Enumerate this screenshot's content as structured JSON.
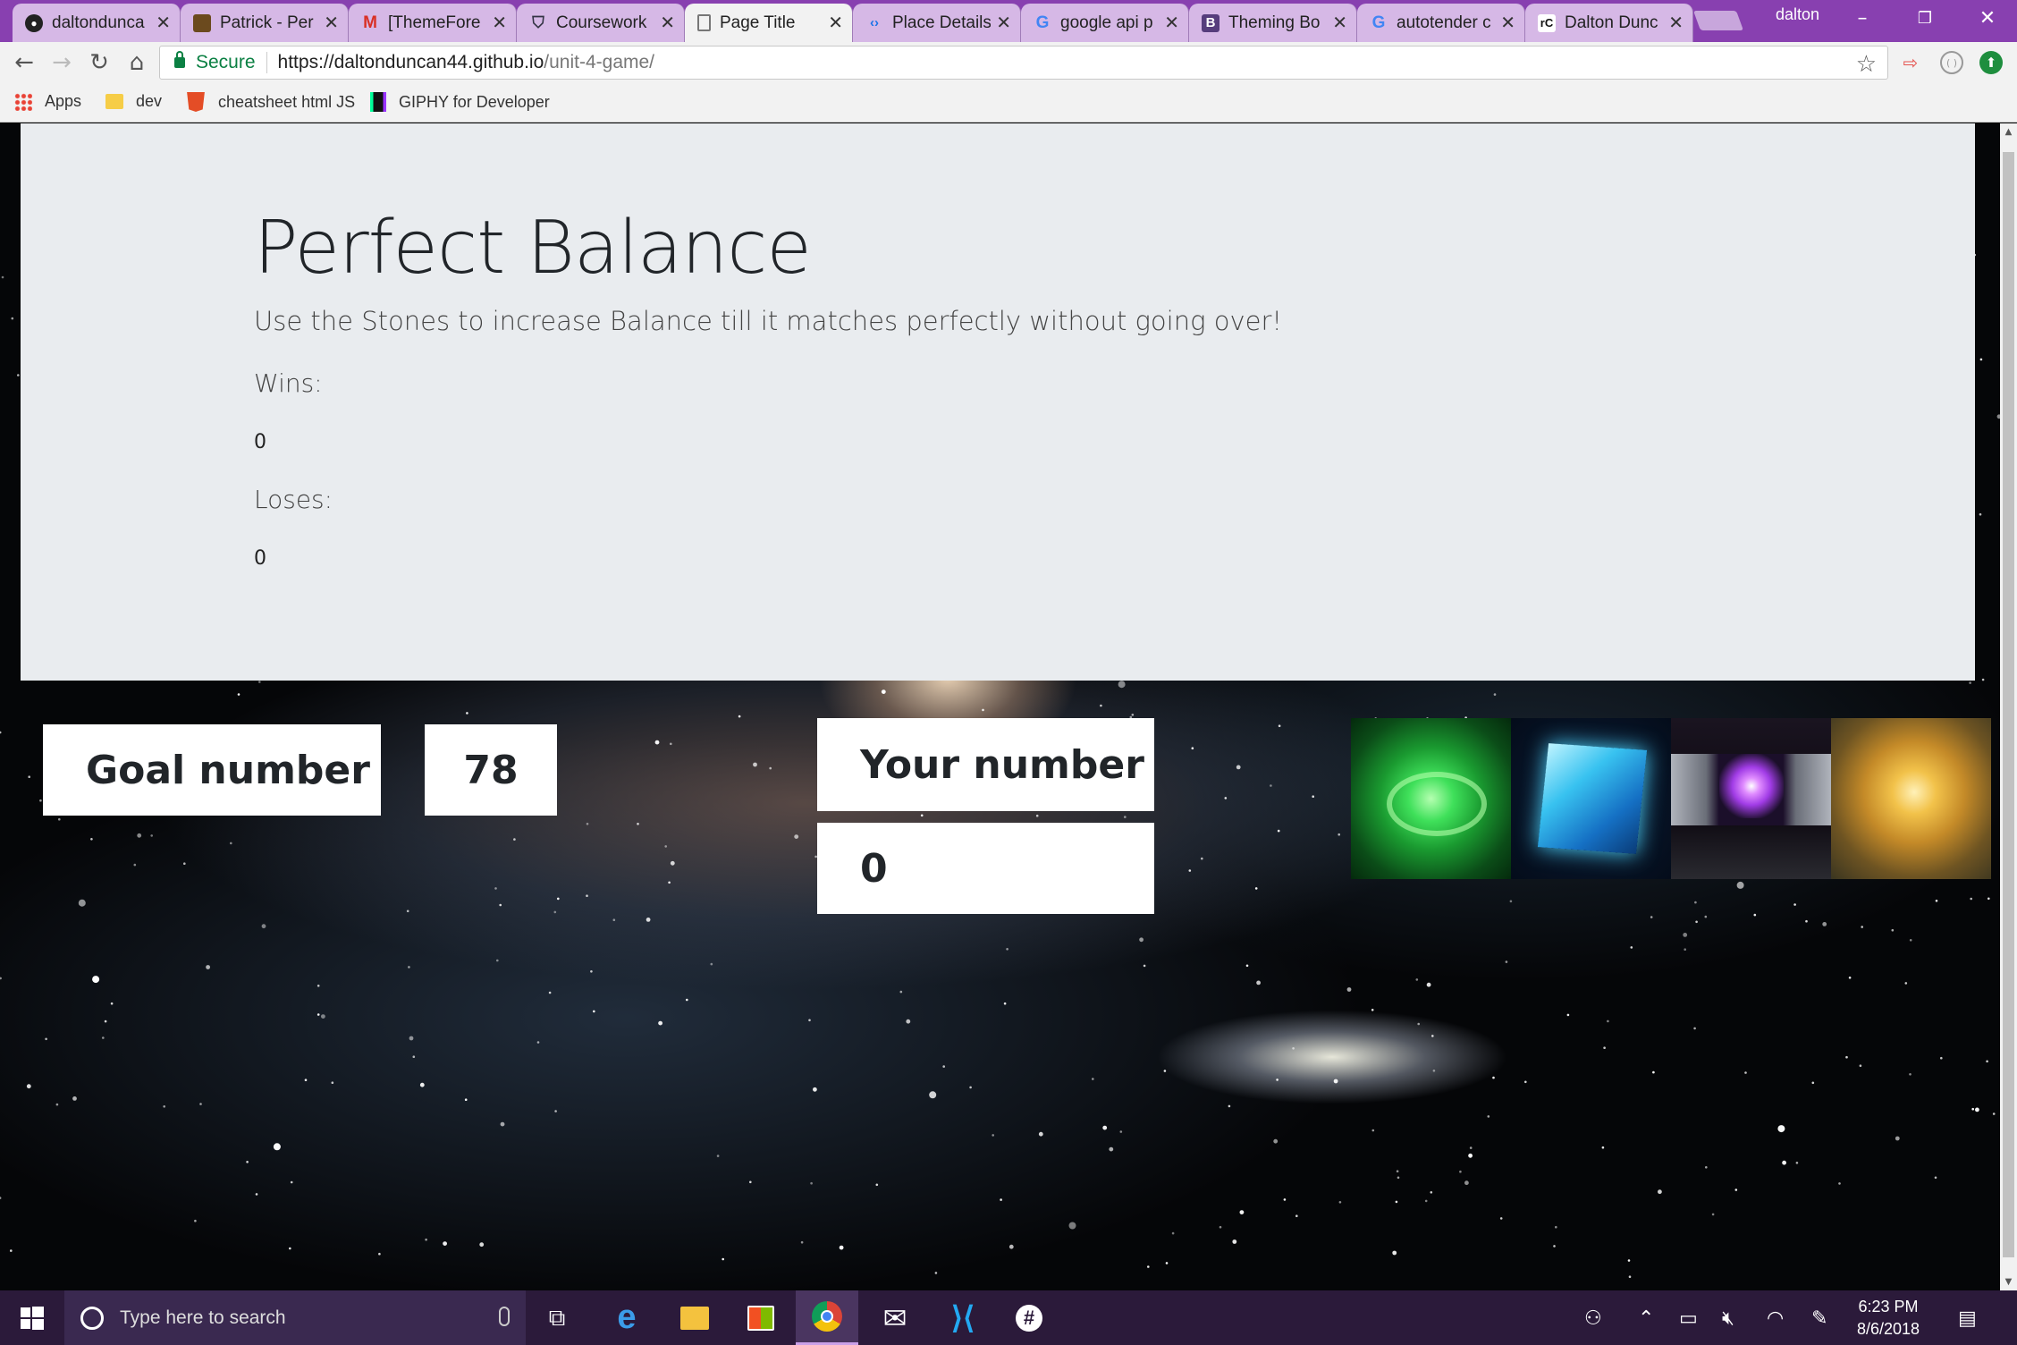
{
  "browser": {
    "tabs": [
      {
        "title": "daltondunca",
        "icon": "github-icon",
        "active": false
      },
      {
        "title": "Patrick - Per",
        "icon": "image-favicon-icon",
        "active": false
      },
      {
        "title": "[ThemeFore",
        "icon": "gmail-icon",
        "active": false
      },
      {
        "title": "Coursework",
        "icon": "shield-favicon-icon",
        "active": false
      },
      {
        "title": "Page Title",
        "icon": "page-icon",
        "active": true
      },
      {
        "title": "Place Details",
        "icon": "google-dev-icon",
        "active": false
      },
      {
        "title": "google api p",
        "icon": "google-icon",
        "active": false
      },
      {
        "title": "Theming Bo",
        "icon": "bootstrap-icon",
        "active": false
      },
      {
        "title": "autotender c",
        "icon": "google-icon",
        "active": false
      },
      {
        "title": "Dalton Dunc",
        "icon": "rc-icon",
        "active": false
      }
    ],
    "user_name": "dalton",
    "secure_label": "Secure",
    "url_host": "https://daltonduncan44.github.io",
    "url_path": "/unit-4-game/",
    "bookmarks": [
      {
        "label": "Apps",
        "icon": "apps-grid-icon"
      },
      {
        "label": "dev",
        "icon": "folder-icon"
      },
      {
        "label": "cheatsheet html JS",
        "icon": "html5-icon"
      },
      {
        "label": "GIPHY for Developer",
        "icon": "giphy-icon"
      }
    ]
  },
  "game": {
    "title": "Perfect Balance",
    "subtitle": "Use the Stones to increase Balance till it matches perfectly without going over!",
    "wins_label": "Wins:",
    "wins_value": "0",
    "loses_label": "Loses:",
    "loses_value": "0",
    "goal_label": "Goal number",
    "goal_value": "78",
    "your_label": "Your number",
    "your_value": "0",
    "stones": [
      {
        "name": "time-stone",
        "color": "#2ecc40"
      },
      {
        "name": "space-stone",
        "color": "#38c2f0"
      },
      {
        "name": "power-stone",
        "color": "#a13ce6"
      },
      {
        "name": "mind-stone",
        "color": "#f2c24a"
      }
    ]
  },
  "taskbar": {
    "search_placeholder": "Type here to search",
    "time": "6:23 PM",
    "date": "8/6/2018",
    "apps": [
      "task-view-icon",
      "edge-icon",
      "file-explorer-icon",
      "store-icon",
      "chrome-icon",
      "mail-icon",
      "vscode-icon",
      "slack-icon"
    ]
  },
  "colors": {
    "tabstrip": "#8840b0",
    "jumbotron": "#e9ecef",
    "secure_green": "#0b8043",
    "taskbar": "#2b1a3a"
  }
}
